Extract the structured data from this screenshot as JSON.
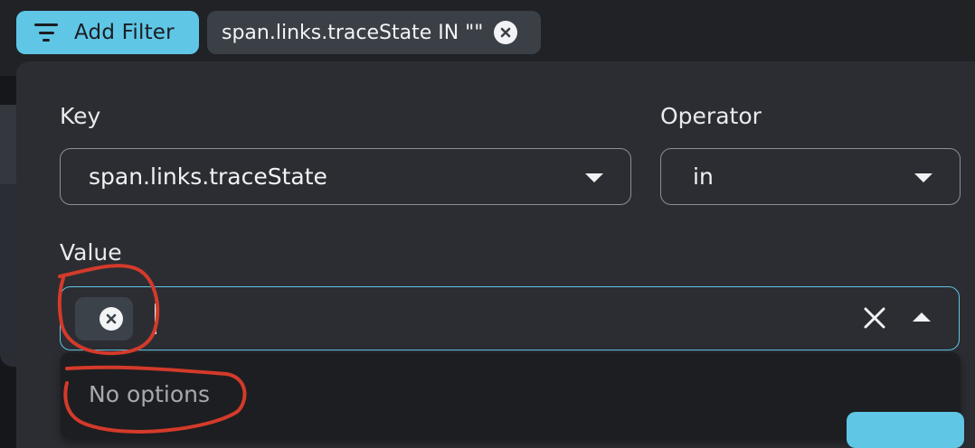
{
  "toolbar": {
    "add_filter_label": "Add Filter",
    "active_filter_chip": "span.links.traceState IN \"\""
  },
  "filter_editor": {
    "key_label": "Key",
    "key_value": "span.links.traceState",
    "operator_label": "Operator",
    "operator_value": "in",
    "value_label": "Value",
    "value_tag_text": "",
    "dropdown_empty_text": "No options"
  },
  "colors": {
    "accent": "#5fc6e6",
    "annotation": "#d43a2a"
  },
  "icons": {
    "filter": "filter-lines-icon",
    "chip_remove": "close-circle-icon",
    "clear": "close-icon",
    "collapse": "caret-up-icon",
    "expand": "caret-down-icon"
  }
}
